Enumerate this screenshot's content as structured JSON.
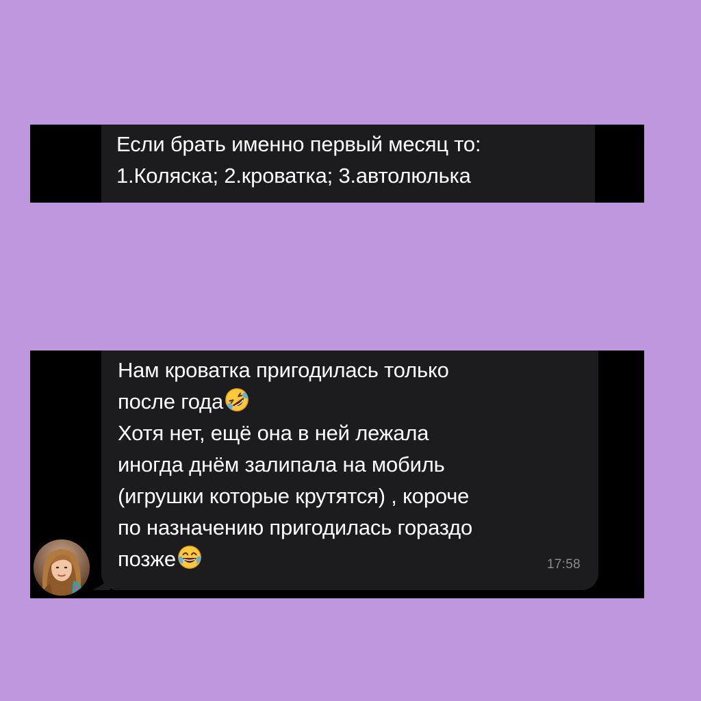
{
  "page": {
    "background_color": "#bf97df"
  },
  "messages": [
    {
      "lines": [
        "Если брать именно первый месяц то:",
        "1.Коляска; 2.кроватка; 3.автолюлька"
      ]
    },
    {
      "lines": [
        "Нам кроватка пригодилась только",
        "после года",
        "Хотя нет, ещё она в ней лежала",
        "иногда днём залипала на мобиль",
        "(игрушки которые крутятся) , короче",
        "по назначению пригодилась гораздо",
        "позже"
      ],
      "time": "17:58",
      "emojis": [
        "rolling-on-floor-laughing-emoji",
        "face-with-tears-of-joy-emoji"
      ]
    }
  ],
  "colors": {
    "panel": "#000000",
    "bubble": "#1c1c1e",
    "text": "#ffffff",
    "time": "#8c8c90"
  }
}
